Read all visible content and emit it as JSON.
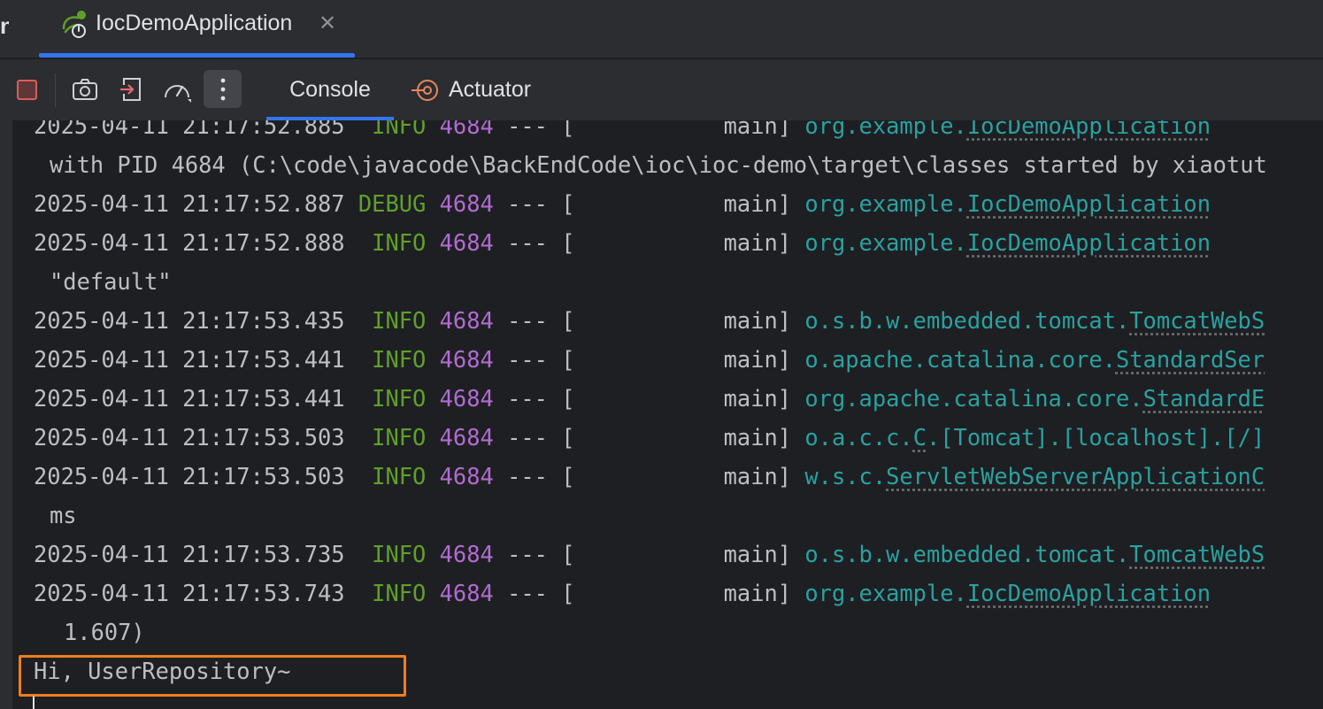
{
  "tab": {
    "title": "IocDemoApplication",
    "close": "✕",
    "icon": "spring-boot-run-icon"
  },
  "toolbar": {
    "buttons": [
      "stop-icon",
      "camera-icon",
      "exit-icon",
      "speedometer-icon",
      "more-vertical-icon"
    ],
    "tabs": [
      {
        "label": "Console",
        "active": true
      },
      {
        "label": "Actuator",
        "active": false
      }
    ]
  },
  "colors": {
    "accent": "#3574f0",
    "info": "#5fa02c",
    "pid": "#b16bd1",
    "logger": "#2aa1a1",
    "highlight": "#f07d20",
    "stop": "#db5c5c"
  },
  "console": {
    "lines": [
      {
        "ts": "2025-04-11 21:17:52.885",
        "level": " INFO",
        "pid": "4684",
        "sep": " --- [",
        "thread": "           main]",
        "pkg": "org.example.",
        "cls": "IocDemoApplication"
      },
      {
        "text": "with PID 4684 (C:\\code\\javacode\\BackEndCode\\ioc\\ioc-demo\\target\\classes started by xiaotut"
      },
      {
        "ts": "2025-04-11 21:17:52.887",
        "level": "DEBUG",
        "pid": "4684",
        "sep": " --- [",
        "thread": "           main]",
        "pkg": "org.example.",
        "cls": "IocDemoApplication"
      },
      {
        "ts": "2025-04-11 21:17:52.888",
        "level": " INFO",
        "pid": "4684",
        "sep": " --- [",
        "thread": "           main]",
        "pkg": "org.example.",
        "cls": "IocDemoApplication"
      },
      {
        "text": "\"default\""
      },
      {
        "ts": "2025-04-11 21:17:53.435",
        "level": " INFO",
        "pid": "4684",
        "sep": " --- [",
        "thread": "           main]",
        "pkg": "o.s.b.w.embedded.tomcat.",
        "cls": "TomcatWebS"
      },
      {
        "ts": "2025-04-11 21:17:53.441",
        "level": " INFO",
        "pid": "4684",
        "sep": " --- [",
        "thread": "           main]",
        "pkg": "o.apache.catalina.core.",
        "cls": "StandardSer"
      },
      {
        "ts": "2025-04-11 21:17:53.441",
        "level": " INFO",
        "pid": "4684",
        "sep": " --- [",
        "thread": "           main]",
        "pkg": "org.apache.catalina.core.",
        "cls": "StandardE"
      },
      {
        "ts": "2025-04-11 21:17:53.503",
        "level": " INFO",
        "pid": "4684",
        "sep": " --- [",
        "thread": "           main]",
        "pkg": "o.a.c.c.",
        "cls": "C",
        "rest": ".[Tomcat].[localhost].[/]"
      },
      {
        "ts": "2025-04-11 21:17:53.503",
        "level": " INFO",
        "pid": "4684",
        "sep": " --- [",
        "thread": "           main]",
        "pkg": "w.s.c.",
        "cls": "ServletWebServerApplicationC"
      },
      {
        "text": "ms"
      },
      {
        "ts": "2025-04-11 21:17:53.735",
        "level": " INFO",
        "pid": "4684",
        "sep": " --- [",
        "thread": "           main]",
        "pkg": "o.s.b.w.embedded.tomcat.",
        "cls": "TomcatWebS"
      },
      {
        "ts": "2025-04-11 21:17:53.743",
        "level": " INFO",
        "pid": "4684",
        "sep": " --- [",
        "thread": "           main]",
        "pkg": "org.example.",
        "cls": "IocDemoApplication"
      },
      {
        "text": "1.607)",
        "deep": true
      },
      {
        "plain": "Hi, UserRepository~"
      }
    ]
  }
}
